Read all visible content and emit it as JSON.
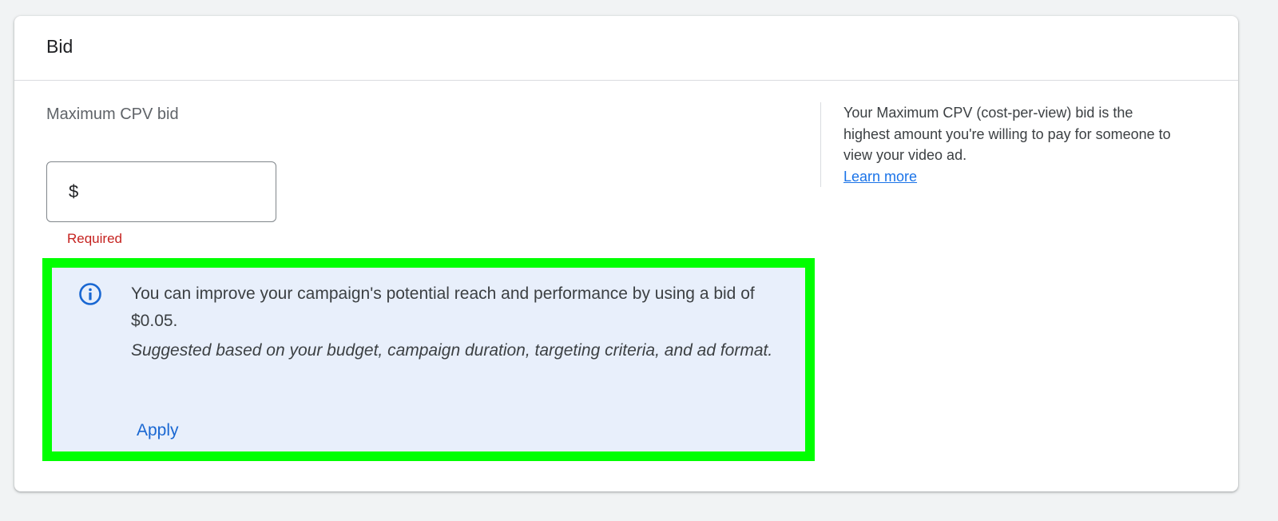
{
  "card": {
    "title": "Bid"
  },
  "bid_field": {
    "label": "Maximum CPV bid",
    "currency_symbol": "$",
    "value": "",
    "error": "Required"
  },
  "recommendation": {
    "icon": "info-icon",
    "message": "You can improve your campaign's potential reach and performance by using a bid of $0.05.",
    "note": "Suggested based on your budget, campaign duration, targeting criteria, and ad format.",
    "apply_label": "Apply",
    "highlight_color": "#00ff00"
  },
  "help": {
    "text": "Your Maximum CPV (cost-per-view) bid is the highest amount you're willing to pay for someone to view your video ad.",
    "link_label": "Learn more"
  },
  "colors": {
    "error": "#c5221f",
    "link": "#1a73e8",
    "accent": "#1967d2",
    "info_background": "#e8effb"
  }
}
